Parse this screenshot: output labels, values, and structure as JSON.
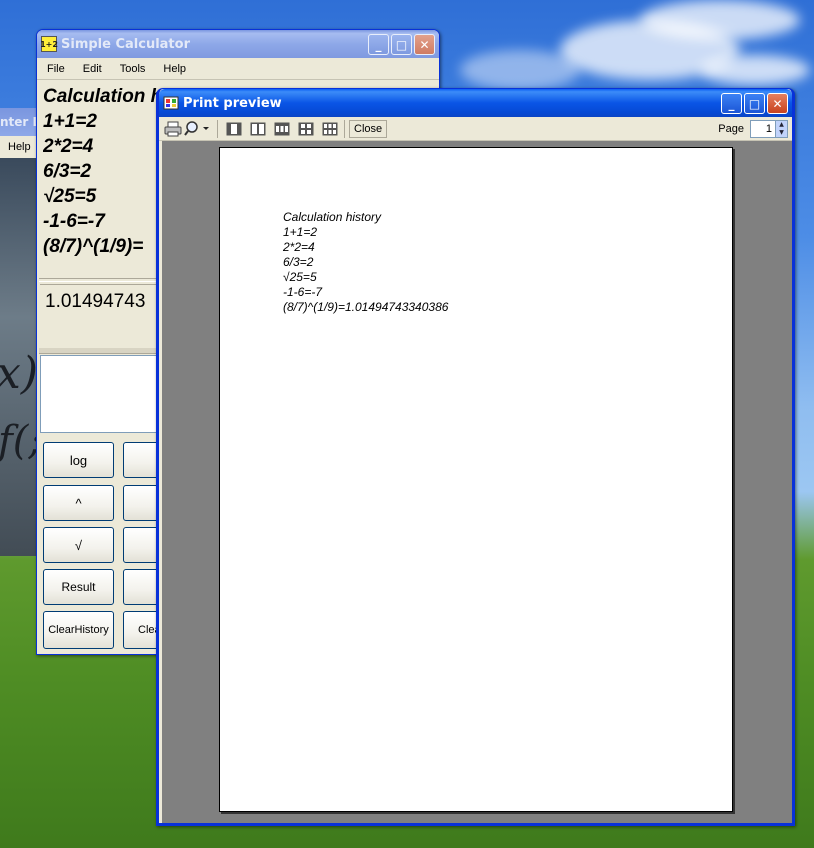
{
  "calculator": {
    "title": "Simple Calculator",
    "icon_text": "1+2",
    "menu": [
      "File",
      "Edit",
      "Tools",
      "Help"
    ],
    "history_lines": [
      "Calculation history",
      "1+1=2",
      "2*2=4",
      "6/3=2",
      "√25=5",
      "-1-6=-7",
      "(8/7)^(1/9)="
    ],
    "result_display": "1.01494743",
    "buttons": {
      "col1": [
        "log",
        "^",
        "√",
        "Result",
        "ClearHistory"
      ],
      "col2_partial": [
        "",
        "",
        "",
        "",
        "Clea"
      ]
    }
  },
  "background_window": {
    "title_partial": "nter L",
    "menu_partial": "Help",
    "math_glyphs": [
      "x)",
      "f(;"
    ]
  },
  "print_preview": {
    "title": "Print preview",
    "toolbar": {
      "close_label": "Close",
      "page_label": "Page",
      "page_value": "1"
    },
    "page_lines": [
      "Calculation history",
      "1+1=2",
      "2*2=4",
      "6/3=2",
      "√25=5",
      "-1-6=-7",
      "(8/7)^(1/9)=1.01494743340386"
    ]
  }
}
